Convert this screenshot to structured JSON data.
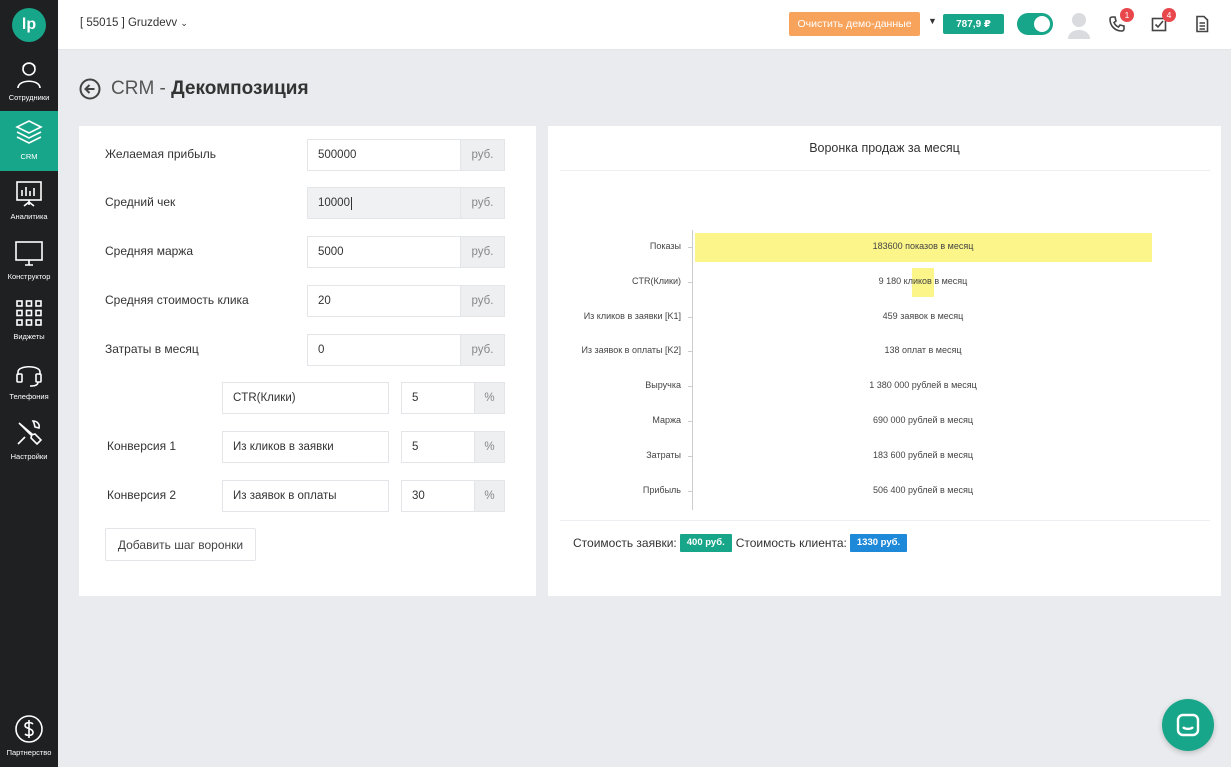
{
  "app": {
    "logo": "lp"
  },
  "sidebar": {
    "items": [
      {
        "label": "Сотрудники",
        "icon": "user-icon",
        "active": false
      },
      {
        "label": "CRM",
        "icon": "layers-icon",
        "active": true
      },
      {
        "label": "Аналитика",
        "icon": "presentation-chart-icon",
        "active": false
      },
      {
        "label": "Конструктор",
        "icon": "monitor-icon",
        "active": false
      },
      {
        "label": "Виджеты",
        "icon": "grid-icon",
        "active": false
      },
      {
        "label": "Телефония",
        "icon": "headset-icon",
        "active": false
      },
      {
        "label": "Настройки",
        "icon": "wrench-icon",
        "active": false
      }
    ],
    "partner": {
      "label": "Партнерство",
      "icon": "dollar-icon"
    }
  },
  "topbar": {
    "account": "[ 55015 ] Gruzdevv",
    "demo_button": "Очистить демо-данные",
    "balance": "787,9 ₽",
    "calls_badge": "1",
    "tasks_badge": "4"
  },
  "page": {
    "title_prefix": "CRM - ",
    "title_main": "Декомпозиция"
  },
  "form": {
    "rows": [
      {
        "label": "Желаемая прибыль",
        "value": "500000",
        "unit": "руб."
      },
      {
        "label": "Средний чек",
        "value": "10000",
        "unit": "руб."
      },
      {
        "label": "Средняя маржа",
        "value": "5000",
        "unit": "руб."
      },
      {
        "label": "Средняя стоимость клика",
        "value": "20",
        "unit": "руб."
      },
      {
        "label": "Затраты в месяц",
        "value": "0",
        "unit": "руб."
      }
    ],
    "steps": [
      {
        "label": "",
        "name": "CTR(Клики)",
        "value": "5",
        "unit": "%"
      },
      {
        "label": "Конверсия 1",
        "name": "Из кликов в заявки",
        "value": "5",
        "unit": "%"
      },
      {
        "label": "Конверсия 2",
        "name": "Из заявок в оплаты",
        "value": "30",
        "unit": "%"
      }
    ],
    "add_step_button": "Добавить шаг воронки"
  },
  "funnel": {
    "title": "Воронка продаж за месяц",
    "rows": [
      {
        "label": "Показы",
        "text": "183600 показов в месяц",
        "fill": 1.0
      },
      {
        "label": "CTR(Клики)",
        "text": "9 180 кликов в месяц",
        "fill": 0.05
      },
      {
        "label": "Из кликов в заявки [K1]",
        "text": "459 заявок в месяц",
        "fill": 0
      },
      {
        "label": "Из заявок в оплаты [K2]",
        "text": "138 оплат в месяц",
        "fill": 0
      },
      {
        "label": "Выручка",
        "text": "1 380 000 рублей в месяц",
        "fill": 0
      },
      {
        "label": "Маржа",
        "text": "690 000 рублей в месяц",
        "fill": 0
      },
      {
        "label": "Затраты",
        "text": "183 600 рублей в месяц",
        "fill": 0
      },
      {
        "label": "Прибыль",
        "text": "506 400 рублей в месяц",
        "fill": 0
      }
    ],
    "lead_cost_label": "Стоимость заявки:",
    "lead_cost_value": "400 руб.",
    "client_cost_label": "Стоимость клиента:",
    "client_cost_value": "1330 руб."
  },
  "colors": {
    "accent": "#17a689",
    "demo": "#f7a35c",
    "bar": "#fbf58a",
    "client_pill": "#1e88d9",
    "badge": "#e8474c"
  }
}
